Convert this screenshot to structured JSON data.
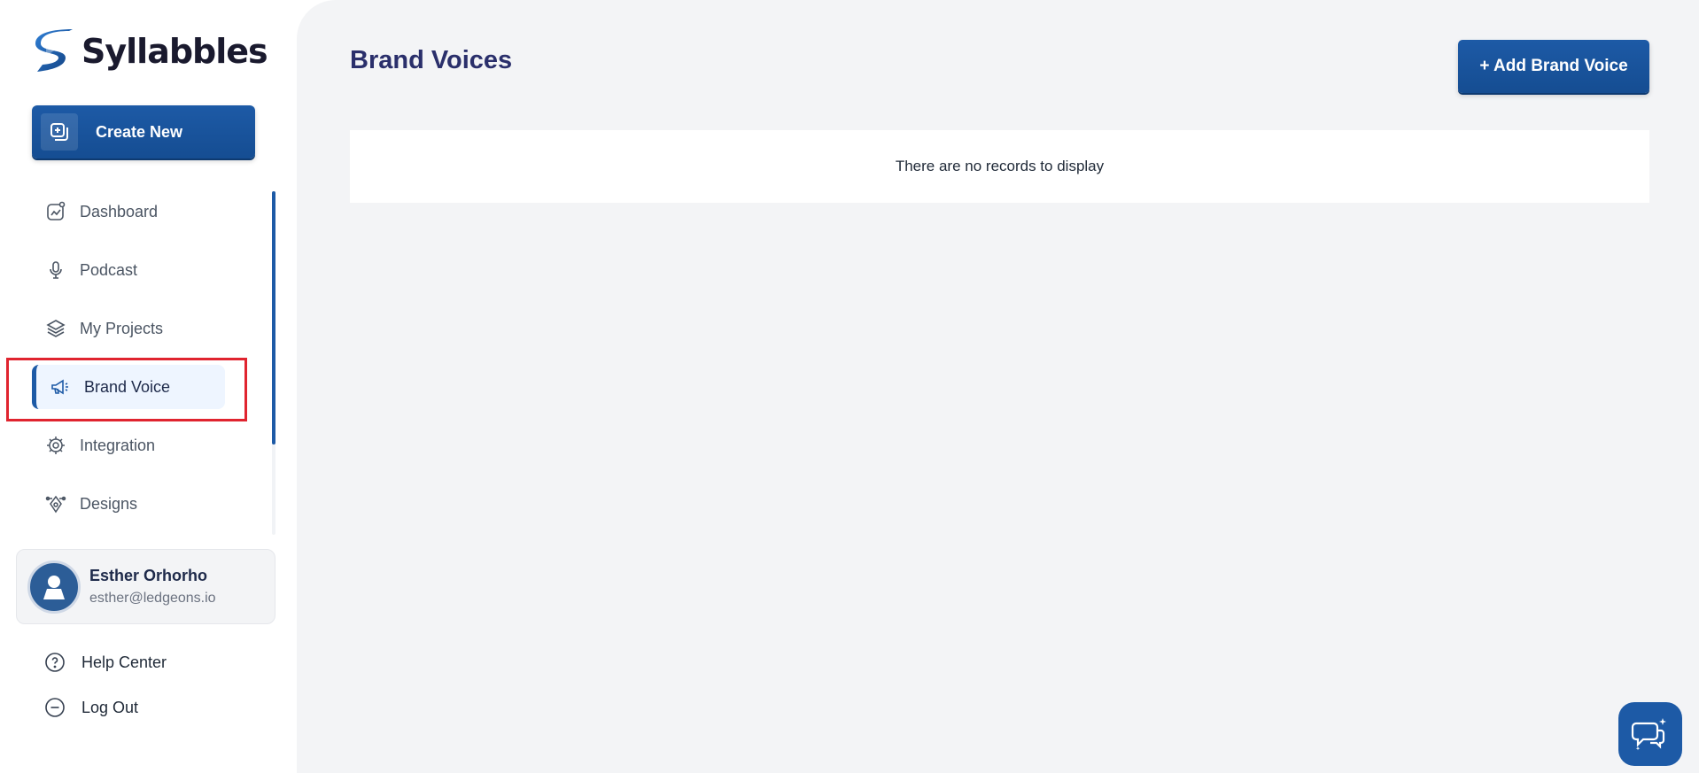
{
  "brand": {
    "name": "Syllabbles"
  },
  "sidebar": {
    "create_label": "Create New",
    "items": [
      {
        "label": "Dashboard",
        "icon": "chart-icon"
      },
      {
        "label": "Podcast",
        "icon": "microphone-icon"
      },
      {
        "label": "My Projects",
        "icon": "layers-icon"
      },
      {
        "label": "Brand Voice",
        "icon": "megaphone-icon",
        "active": true
      },
      {
        "label": "Integration",
        "icon": "integration-gear-icon"
      },
      {
        "label": "Designs",
        "icon": "pen-tool-icon"
      }
    ],
    "user": {
      "name": "Esther Orhorho",
      "email": "esther@ledgeons.io"
    },
    "help_label": "Help Center",
    "logout_label": "Log Out"
  },
  "main": {
    "title": "Brand Voices",
    "add_button_label": "+ Add Brand Voice",
    "empty_message": "There are no records to display"
  },
  "colors": {
    "primary": "#1d5aa6",
    "title": "#2a2f6b",
    "active_bg": "#eef5ff",
    "highlight": "#e0242f",
    "main_bg": "#f3f4f6"
  }
}
